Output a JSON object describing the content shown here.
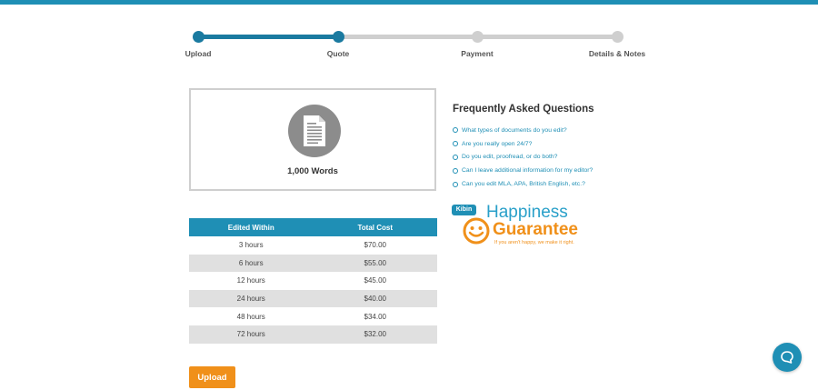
{
  "stepper": {
    "steps": [
      {
        "label": "Upload",
        "state": "complete"
      },
      {
        "label": "Quote",
        "state": "active"
      },
      {
        "label": "Payment",
        "state": "upcoming"
      },
      {
        "label": "Details & Notes",
        "state": "upcoming"
      }
    ]
  },
  "document": {
    "icon": "document-icon",
    "word_count": "1,000 Words"
  },
  "pricing": {
    "headers": {
      "edited_within": "Edited Within",
      "total_cost": "Total Cost"
    },
    "rows": [
      {
        "time": "3 hours",
        "cost": "$70.00"
      },
      {
        "time": "6 hours",
        "cost": "$55.00"
      },
      {
        "time": "12 hours",
        "cost": "$45.00"
      },
      {
        "time": "24 hours",
        "cost": "$40.00"
      },
      {
        "time": "48 hours",
        "cost": "$34.00"
      },
      {
        "time": "72 hours",
        "cost": "$32.00"
      }
    ]
  },
  "upload_button": {
    "label": "Upload"
  },
  "faq": {
    "title": "Frequently Asked Questions",
    "items": [
      "What types of documents do you edit?",
      "Are you really open 24/7?",
      "Do you edit, proofread, or do both?",
      "Can I leave additional information for my editor?",
      "Can you edit MLA, APA, British English, etc.?"
    ]
  },
  "guarantee": {
    "brand": "Kibin",
    "line1": "Happiness",
    "line2": "Guarantee",
    "tagline": "If you aren't happy, we make it right."
  },
  "colors": {
    "primary": "#1f8fb5",
    "stepper_active": "#1a7aa0",
    "accent_orange": "#f0901a",
    "inactive_gray": "#cfcfcf",
    "row_alt": "#e0e0e0"
  },
  "chat": {
    "icon": "chat-icon"
  }
}
